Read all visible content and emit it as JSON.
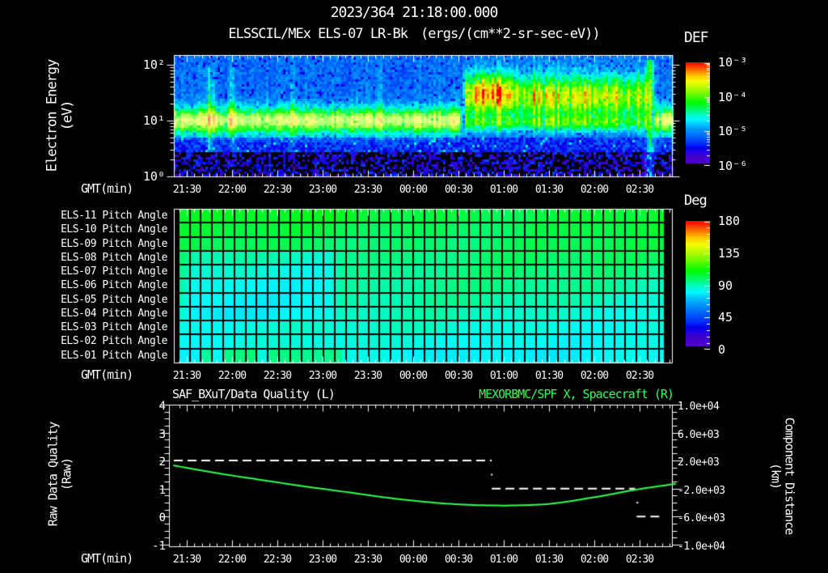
{
  "header": {
    "datetime": "2023/364 21:18:00.000",
    "instrument": "ELSSCIL/MEx ELS-07 LR-Bk",
    "units": "(ergs/(cm**2-sr-sec-eV))"
  },
  "time_axis": {
    "label": "GMT(min)",
    "start_gmt": "21:18",
    "end_gmt": "02:53",
    "labels": [
      "21:30",
      "22:00",
      "22:30",
      "23:00",
      "23:30",
      "00:00",
      "00:30",
      "01:00",
      "01:30",
      "02:00",
      "02:30"
    ]
  },
  "spectrogram": {
    "ylabel": "Electron Energy",
    "ylabel_units": "(eV)",
    "yticks": [
      "10²",
      "10¹",
      "10⁰"
    ],
    "colorbar_title": "DEF",
    "colorbar_ticks": [
      "10⁻³",
      "10⁻⁴",
      "10⁻⁵",
      "10⁻⁶"
    ]
  },
  "pitch": {
    "row_labels": [
      "ELS-11 Pitch Angle",
      "ELS-10 Pitch Angle",
      "ELS-09 Pitch Angle",
      "ELS-08 Pitch Angle",
      "ELS-07 Pitch Angle",
      "ELS-06 Pitch Angle",
      "ELS-05 Pitch Angle",
      "ELS-04 Pitch Angle",
      "ELS-03 Pitch Angle",
      "ELS-02 Pitch Angle",
      "ELS-01 Pitch Angle"
    ],
    "colorbar_title": "Deg",
    "colorbar_ticks": [
      "180",
      "135",
      "90",
      "45",
      "0"
    ]
  },
  "bottom": {
    "title_left": "SAF_BXuT/Data Quality (L)",
    "title_right": "MEXORBMC/SPF X, Spacecraft (R)",
    "ylabel_left": "Raw Data Quality",
    "ylabel_left_units": "(Raw)",
    "yticks_left": [
      "4",
      "3",
      "2",
      "1",
      "0",
      "-1"
    ],
    "ylabel_right": "Component Distance",
    "ylabel_right_units": "(km)",
    "yticks_right": [
      "1.0e+04",
      "6.0e+03",
      "2.0e+03",
      "-2.0e+03",
      "-6.0e+03",
      "-1.0e+04"
    ]
  },
  "colors": {
    "background": "#000000",
    "text": "#ffffff",
    "accent_green": "#2dff50"
  },
  "chart_data": [
    {
      "type": "heatmap",
      "name": "electron_energy_spectrogram",
      "title": "ELSSCIL/MEx ELS-07 LR-Bk",
      "value_units": "ergs/(cm**2-sr-sec-eV)",
      "x_range_gmt": [
        "21:18",
        "02:53"
      ],
      "y_scale": "log",
      "y_range_ev": [
        1,
        150
      ],
      "color_range": [
        1e-06,
        0.001
      ],
      "features": {
        "photoelectron_band": {
          "gmt": [
            "21:18",
            "00:33"
          ],
          "energy_ev": [
            6,
            25
          ],
          "flux": "~1e-4"
        },
        "heated_plasma_band": {
          "gmt": [
            "00:33",
            "02:37"
          ],
          "energy_ev": [
            8,
            70
          ],
          "flux": "2e-4 to 8e-4 with yellow patches 00:35-00:55 near 40 eV"
        },
        "vertical_streaks_gmt": [
          "21:44",
          "21:47",
          "22:00",
          "22:40",
          "23:38"
        ],
        "flux_spike_gmt": "02:37",
        "band_returns_low_gmt": [
          "02:40",
          "02:52"
        ]
      },
      "render": {
        "pre_band": {
          "m": [
            0,
            195
          ],
          "logc": 1.0,
          "sig": 0.17,
          "amp": 0.44
        },
        "post_band": {
          "m": [
            195,
            318
          ],
          "logc": 1.42,
          "sig": 0.27,
          "amp": 0.47
        },
        "post_low": {
          "m": [
            195,
            318
          ],
          "logc": 0.95,
          "sig": 0.1,
          "amp": 0.26
        },
        "tail_band": {
          "m": [
            321,
            338
          ],
          "logc": 1.0,
          "sig": 0.17,
          "amp": 0.44
        },
        "blob": {
          "mc": 214,
          "msig": 10,
          "logc": 1.58,
          "sig": 0.22,
          "amp": 0.22
        },
        "streaks": [
          [
            26.5,
            0.3
          ],
          [
            29,
            0.18
          ],
          [
            42,
            0.26
          ],
          [
            82,
            0.12
          ],
          [
            140,
            0.12
          ],
          [
            180,
            0.08
          ]
        ],
        "spike": {
          "m": 319,
          "amp": 0.45,
          "w": 1.6
        }
      }
    },
    {
      "type": "heatmap",
      "name": "pitch_angle_panels",
      "rows": [
        "ELS-11",
        "ELS-10",
        "ELS-09",
        "ELS-08",
        "ELS-07",
        "ELS-06",
        "ELS-05",
        "ELS-04",
        "ELS-03",
        "ELS-02",
        "ELS-01"
      ],
      "value_units": "degrees",
      "color_range": [
        0,
        180
      ],
      "typical_values_deg": {
        "top_rows": 105,
        "bottom_rows": 86,
        "cyan_patch": {
          "gmt": [
            "21:25",
            "23:18"
          ],
          "rows": "ELS-04 to ELS-08",
          "deg": 84
        },
        "data_gap_gmt": [
          [
            "21:18",
            "21:25"
          ],
          [
            "02:45",
            "02:53"
          ]
        ]
      },
      "render": {
        "deg_top": 107,
        "deg_step": -2.2,
        "rows": 11,
        "patch": {
          "m": [
            8,
            113
          ],
          "rows": [
            3,
            7
          ],
          "delta": -9
        },
        "bottom_patch": {
          "m": [
            14,
            114
          ],
          "row": 10,
          "delta": 13
        },
        "gap_m": [
          6.5,
          327
        ],
        "grid_cols_min": 7.4
      }
    },
    {
      "type": "line",
      "name": "quality_and_spacecraft_distance",
      "series": [
        {
          "name": "SAF_BXuT/Data Quality (L)",
          "axis": "left",
          "style": "dashed",
          "color": "#ffffff",
          "segments": [
            {
              "value": 2,
              "m": [
                3.4,
                214
              ],
              "gmt": [
                "21:21",
                "00:52"
              ]
            },
            {
              "value": 1,
              "m": [
                214,
                309
              ],
              "gmt": [
                "00:52",
                "02:27"
              ]
            },
            {
              "value": 0,
              "m": [
                310,
                326
              ],
              "gmt": [
                "02:28",
                "02:44"
              ]
            }
          ],
          "connector_dots": [
            [
              214,
              1.5
            ],
            [
              310.5,
              0.5
            ]
          ]
        },
        {
          "name": "MEXORBMC/SPF X, Spacecraft (R)",
          "axis": "right",
          "style": "solid",
          "color": "#2dff50",
          "points_min_left_km": [
            [
              3,
              1.83,
              1320
            ],
            [
              30,
              1.57,
              280
            ],
            [
              60,
              1.32,
              -720
            ],
            [
              90,
              1.08,
              -1680
            ],
            [
              120,
              0.86,
              -2560
            ],
            [
              150,
              0.64,
              -3440
            ],
            [
              180,
              0.48,
              -4080
            ],
            [
              205,
              0.41,
              -4360
            ],
            [
              230,
              0.4,
              -4400
            ],
            [
              255,
              0.47,
              -4120
            ],
            [
              285,
              0.72,
              -3120
            ],
            [
              305,
              0.92,
              -2320
            ],
            [
              320,
              1.05,
              -1800
            ],
            [
              336,
              1.17,
              -1320
            ]
          ]
        }
      ],
      "y_left": {
        "label": "Raw Data Quality (Raw)",
        "range": [
          -1,
          4
        ]
      },
      "y_right": {
        "label": "Component Distance (km)",
        "range": [
          -10000,
          10000
        ]
      }
    }
  ]
}
